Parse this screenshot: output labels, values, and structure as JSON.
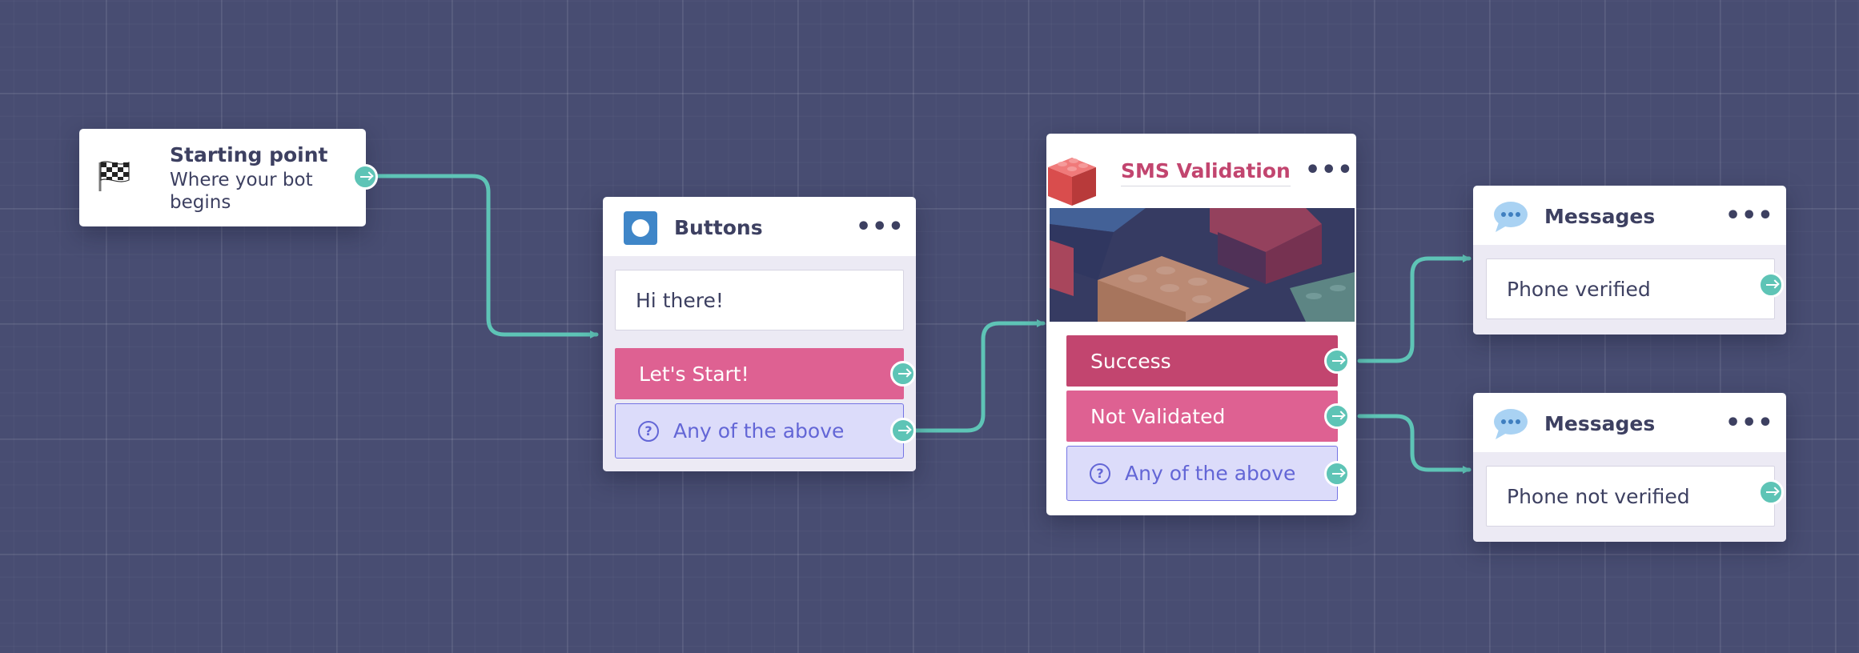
{
  "start": {
    "title": "Starting point",
    "subtitle_line1": "Where your bot",
    "subtitle_line2": "begins",
    "icon": "checkered-flag-icon"
  },
  "buttons_node": {
    "title": "Buttons",
    "menu": "•••",
    "message": "Hi there!",
    "option1": "Let's Start!",
    "option2": "Any of the above",
    "icon": "buttons-block-icon"
  },
  "sms_node": {
    "title": "SMS Validation",
    "menu": "•••",
    "option1": "Success",
    "option2": "Not Validated",
    "option3": "Any of the above",
    "icon": "lego-brick-icon"
  },
  "messages_verified": {
    "title": "Messages",
    "menu": "•••",
    "text": "Phone verified",
    "icon": "speech-bubble-icon"
  },
  "messages_not_verified": {
    "title": "Messages",
    "menu": "•••",
    "text": "Phone not verified",
    "icon": "speech-bubble-icon"
  },
  "colors": {
    "canvas": "#484d72",
    "connector": "#5ec4b6",
    "pink_dark": "#c2456f",
    "pink": "#de6192",
    "any_bg": "#dcdcfa",
    "any_text": "#6366d6"
  }
}
